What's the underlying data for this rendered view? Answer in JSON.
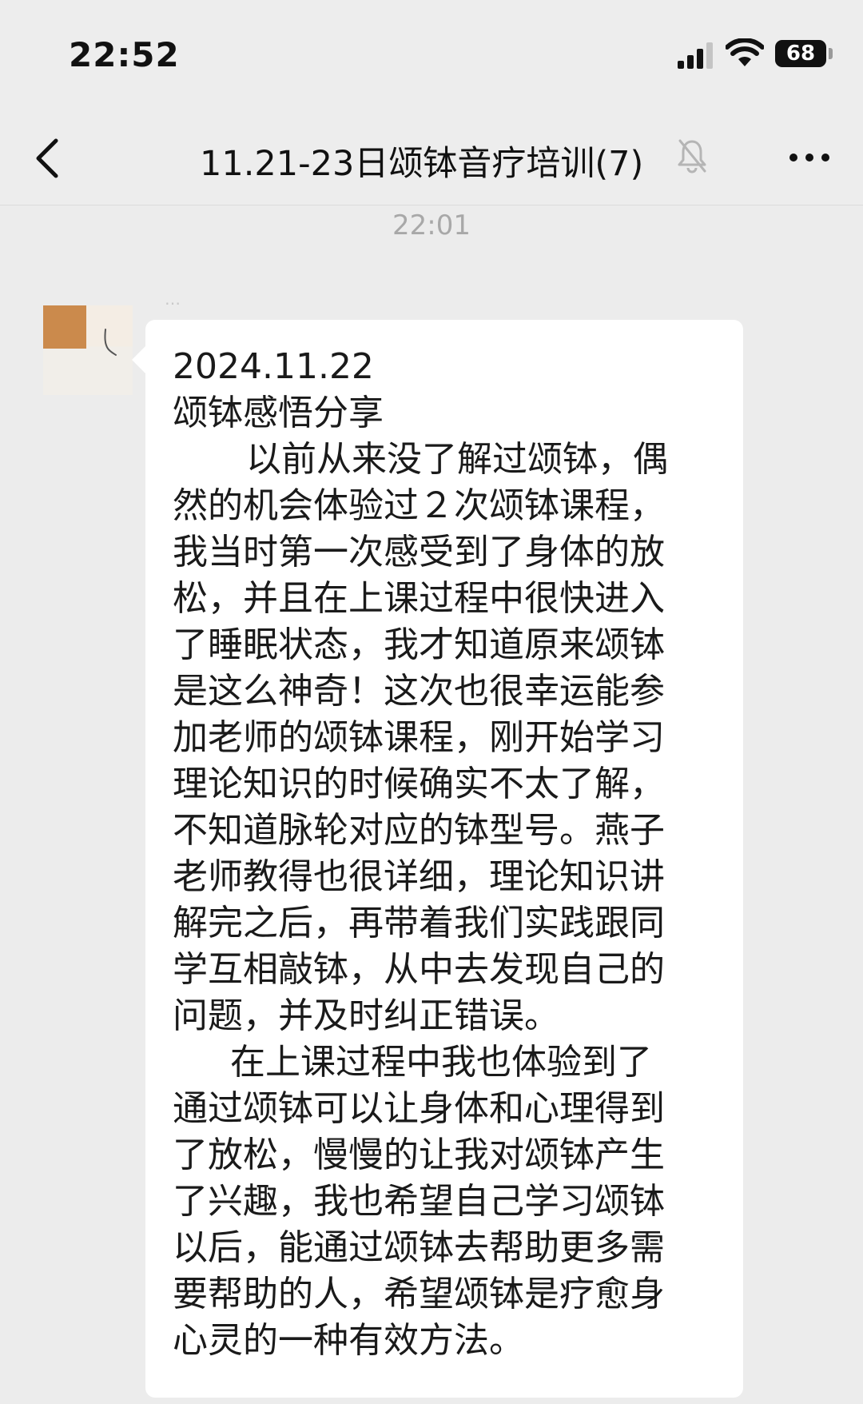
{
  "status_bar": {
    "time": "22:52",
    "battery": "68",
    "icons": [
      "signal-icon",
      "wifi-icon",
      "battery-icon"
    ]
  },
  "nav": {
    "title": "11.21-23日颂钵音疗培训(7)",
    "icons": [
      "back-icon",
      "mute-icon",
      "more-icon"
    ]
  },
  "chat": {
    "time_divider": "22:01",
    "sender_name": "…",
    "message": {
      "lines": [
        "2024.11.22",
        "颂钵感悟分享",
        "以前从来没了解过颂钵，偶",
        "然的机会体验过２次颂钵课程，",
        "我当时第一次感受到了身体的放",
        "松，并且在上课过程中很快进入",
        "了睡眠状态，我才知道原来颂钵",
        "是这么神奇！这次也很幸运能参",
        "加老师的颂钵课程，刚开始学习",
        "理论知识的时候确实不太了解，",
        "不知道脉轮对应的钵型号。燕子",
        "老师教得也很详细，理论知识讲",
        "解完之后，再带着我们实践跟同",
        "学互相敲钵，从中去发现自己的",
        "问题，并及时纠正错误。",
        "在上课过程中我也体验到了",
        "通过颂钵可以让身体和心理得到",
        "了放松，慢慢的让我对颂钵产生",
        "了兴趣，我也希望自己学习颂钵",
        "以后，能通过颂钵去帮助更多需",
        "要帮助的人，希望颂钵是疗愈身",
        "心灵的一种有效方法。"
      ]
    }
  },
  "colors": {
    "background": "#ececec",
    "bubble": "#ffffff",
    "text": "#1a1a1a",
    "divider_text": "#a8a8a8"
  }
}
